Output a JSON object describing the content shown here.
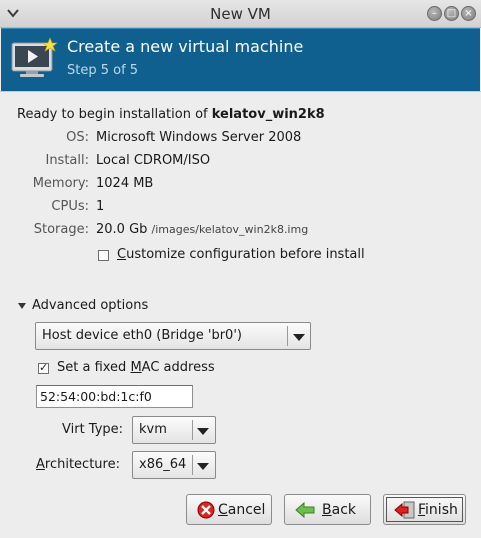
{
  "window": {
    "title": "New VM"
  },
  "header": {
    "title": "Create a new virtual machine",
    "step": "Step 5 of 5"
  },
  "summary": {
    "ready_prefix": "Ready to begin installation of ",
    "vm_name": "kelatov_win2k8",
    "rows": [
      {
        "label": "OS:",
        "value": "Microsoft Windows Server 2008"
      },
      {
        "label": "Install:",
        "value": "Local CDROM/ISO"
      },
      {
        "label": "Memory:",
        "value": "1024 MB"
      },
      {
        "label": "CPUs:",
        "value": "1"
      },
      {
        "label": "Storage:",
        "value": "20.0 Gb",
        "path": "/images/kelatov_win2k8.img"
      }
    ],
    "customize": {
      "label": "Customize configuration before install",
      "checked": false
    }
  },
  "advanced": {
    "label": "Advanced options",
    "network": "Host device eth0 (Bridge 'br0')",
    "fixed_mac": {
      "label": "Set a fixed MAC address",
      "checked": true
    },
    "mac_value": "52:54:00:bd:1c:f0",
    "virt_type_label": "Virt Type:",
    "virt_type": "kvm",
    "arch_label": "Architecture:",
    "arch": "x86_64"
  },
  "buttons": {
    "cancel": "Cancel",
    "back": "Back",
    "finish": "Finish"
  },
  "colors": {
    "header_bg": "#10608f",
    "header_subtitle": "#bcd8ec"
  }
}
